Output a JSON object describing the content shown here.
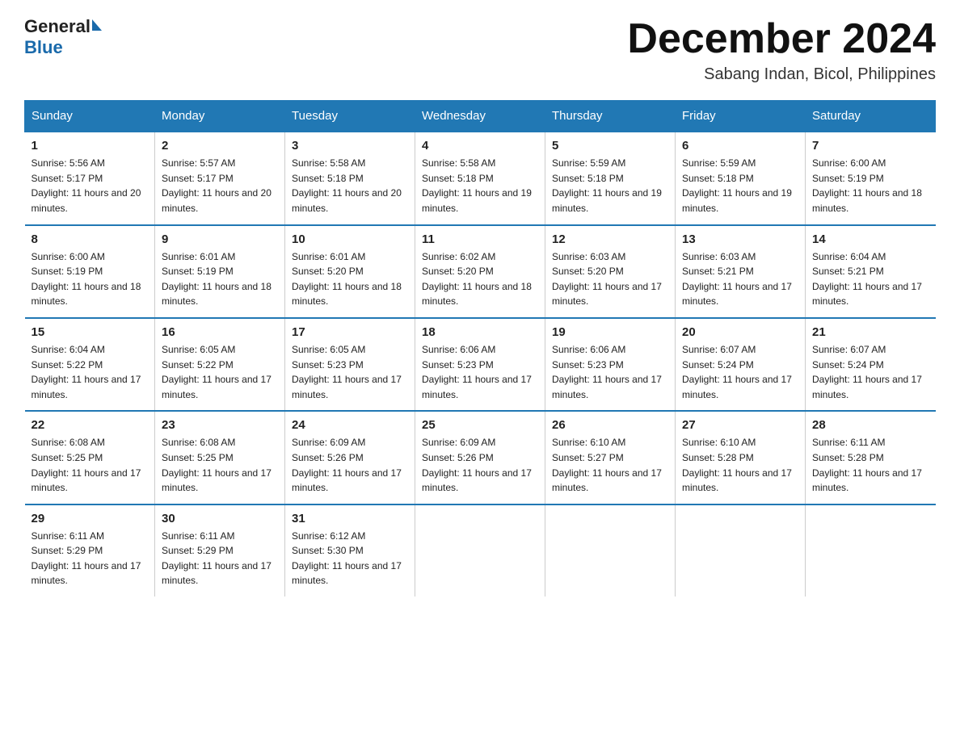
{
  "header": {
    "logo_general": "General",
    "logo_blue": "Blue",
    "month_title": "December 2024",
    "subtitle": "Sabang Indan, Bicol, Philippines"
  },
  "days_of_week": [
    "Sunday",
    "Monday",
    "Tuesday",
    "Wednesday",
    "Thursday",
    "Friday",
    "Saturday"
  ],
  "weeks": [
    [
      {
        "day": "1",
        "sunrise": "5:56 AM",
        "sunset": "5:17 PM",
        "daylight": "11 hours and 20 minutes."
      },
      {
        "day": "2",
        "sunrise": "5:57 AM",
        "sunset": "5:17 PM",
        "daylight": "11 hours and 20 minutes."
      },
      {
        "day": "3",
        "sunrise": "5:58 AM",
        "sunset": "5:18 PM",
        "daylight": "11 hours and 20 minutes."
      },
      {
        "day": "4",
        "sunrise": "5:58 AM",
        "sunset": "5:18 PM",
        "daylight": "11 hours and 19 minutes."
      },
      {
        "day": "5",
        "sunrise": "5:59 AM",
        "sunset": "5:18 PM",
        "daylight": "11 hours and 19 minutes."
      },
      {
        "day": "6",
        "sunrise": "5:59 AM",
        "sunset": "5:18 PM",
        "daylight": "11 hours and 19 minutes."
      },
      {
        "day": "7",
        "sunrise": "6:00 AM",
        "sunset": "5:19 PM",
        "daylight": "11 hours and 18 minutes."
      }
    ],
    [
      {
        "day": "8",
        "sunrise": "6:00 AM",
        "sunset": "5:19 PM",
        "daylight": "11 hours and 18 minutes."
      },
      {
        "day": "9",
        "sunrise": "6:01 AM",
        "sunset": "5:19 PM",
        "daylight": "11 hours and 18 minutes."
      },
      {
        "day": "10",
        "sunrise": "6:01 AM",
        "sunset": "5:20 PM",
        "daylight": "11 hours and 18 minutes."
      },
      {
        "day": "11",
        "sunrise": "6:02 AM",
        "sunset": "5:20 PM",
        "daylight": "11 hours and 18 minutes."
      },
      {
        "day": "12",
        "sunrise": "6:03 AM",
        "sunset": "5:20 PM",
        "daylight": "11 hours and 17 minutes."
      },
      {
        "day": "13",
        "sunrise": "6:03 AM",
        "sunset": "5:21 PM",
        "daylight": "11 hours and 17 minutes."
      },
      {
        "day": "14",
        "sunrise": "6:04 AM",
        "sunset": "5:21 PM",
        "daylight": "11 hours and 17 minutes."
      }
    ],
    [
      {
        "day": "15",
        "sunrise": "6:04 AM",
        "sunset": "5:22 PM",
        "daylight": "11 hours and 17 minutes."
      },
      {
        "day": "16",
        "sunrise": "6:05 AM",
        "sunset": "5:22 PM",
        "daylight": "11 hours and 17 minutes."
      },
      {
        "day": "17",
        "sunrise": "6:05 AM",
        "sunset": "5:23 PM",
        "daylight": "11 hours and 17 minutes."
      },
      {
        "day": "18",
        "sunrise": "6:06 AM",
        "sunset": "5:23 PM",
        "daylight": "11 hours and 17 minutes."
      },
      {
        "day": "19",
        "sunrise": "6:06 AM",
        "sunset": "5:23 PM",
        "daylight": "11 hours and 17 minutes."
      },
      {
        "day": "20",
        "sunrise": "6:07 AM",
        "sunset": "5:24 PM",
        "daylight": "11 hours and 17 minutes."
      },
      {
        "day": "21",
        "sunrise": "6:07 AM",
        "sunset": "5:24 PM",
        "daylight": "11 hours and 17 minutes."
      }
    ],
    [
      {
        "day": "22",
        "sunrise": "6:08 AM",
        "sunset": "5:25 PM",
        "daylight": "11 hours and 17 minutes."
      },
      {
        "day": "23",
        "sunrise": "6:08 AM",
        "sunset": "5:25 PM",
        "daylight": "11 hours and 17 minutes."
      },
      {
        "day": "24",
        "sunrise": "6:09 AM",
        "sunset": "5:26 PM",
        "daylight": "11 hours and 17 minutes."
      },
      {
        "day": "25",
        "sunrise": "6:09 AM",
        "sunset": "5:26 PM",
        "daylight": "11 hours and 17 minutes."
      },
      {
        "day": "26",
        "sunrise": "6:10 AM",
        "sunset": "5:27 PM",
        "daylight": "11 hours and 17 minutes."
      },
      {
        "day": "27",
        "sunrise": "6:10 AM",
        "sunset": "5:28 PM",
        "daylight": "11 hours and 17 minutes."
      },
      {
        "day": "28",
        "sunrise": "6:11 AM",
        "sunset": "5:28 PM",
        "daylight": "11 hours and 17 minutes."
      }
    ],
    [
      {
        "day": "29",
        "sunrise": "6:11 AM",
        "sunset": "5:29 PM",
        "daylight": "11 hours and 17 minutes."
      },
      {
        "day": "30",
        "sunrise": "6:11 AM",
        "sunset": "5:29 PM",
        "daylight": "11 hours and 17 minutes."
      },
      {
        "day": "31",
        "sunrise": "6:12 AM",
        "sunset": "5:30 PM",
        "daylight": "11 hours and 17 minutes."
      },
      null,
      null,
      null,
      null
    ]
  ]
}
